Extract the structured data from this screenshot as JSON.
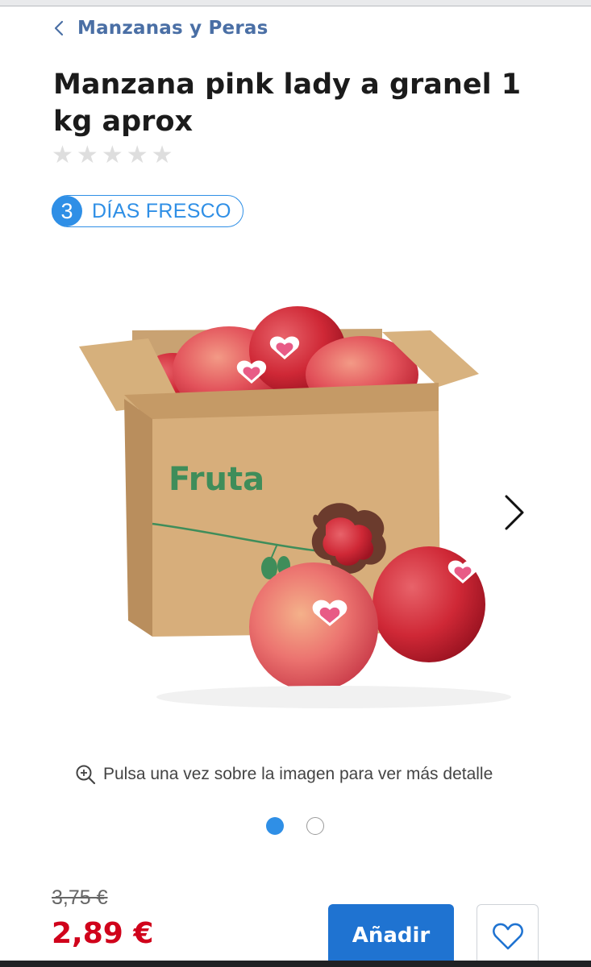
{
  "breadcrumb": {
    "label": "Manzanas y Peras",
    "icon": "chevron-left-icon"
  },
  "product": {
    "title": "Manzana pink lady a granel 1 kg aprox",
    "rating": {
      "stars_filled": 0,
      "stars_total": 5
    },
    "freshness": {
      "days": "3",
      "label": "DÍAS FRESCO"
    },
    "image": {
      "box_text": "Fruta",
      "hint": "Pulsa una vez sobre la imagen para ver más detalle"
    },
    "gallery": {
      "pages": 2,
      "current": 1
    }
  },
  "price": {
    "old": "3,75 €",
    "current": "2,89 €"
  },
  "actions": {
    "add_label": "Añadir",
    "favorite_icon": "heart-outline-icon"
  },
  "colors": {
    "accent": "#2f8fe6",
    "primary_button": "#1f73d1",
    "price": "#d0021b",
    "breadcrumb": "#4a6fa5"
  }
}
